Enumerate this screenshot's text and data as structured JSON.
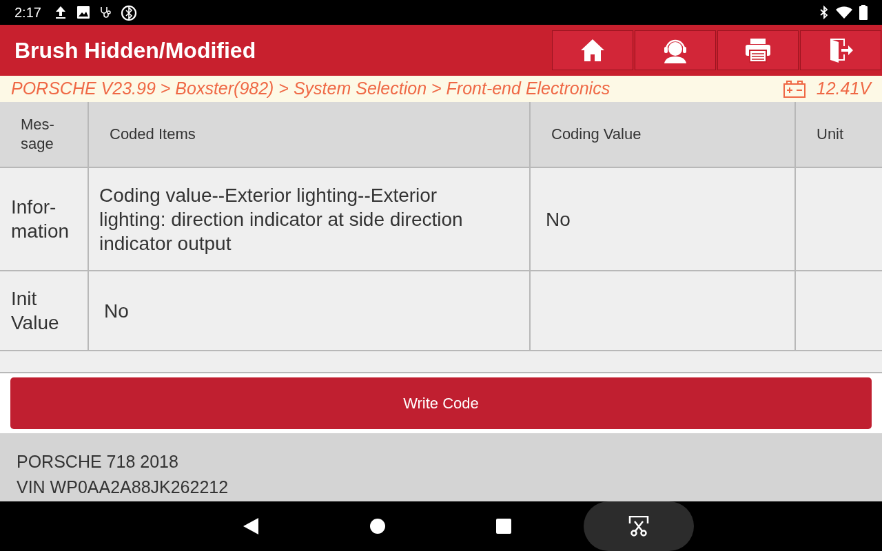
{
  "status_bar": {
    "time": "2:17"
  },
  "header": {
    "title": "Brush Hidden/Modified",
    "buttons": [
      {
        "kind": "home"
      },
      {
        "kind": "support"
      },
      {
        "kind": "print"
      },
      {
        "kind": "exit"
      }
    ]
  },
  "breadcrumb": {
    "path": "PORSCHE V23.99 > Boxster(982) > System Selection > Front-end Electronics",
    "voltage": "12.41V"
  },
  "table": {
    "columns": [
      "Mes-\nsage",
      "Coded Items",
      "Coding Value",
      "Unit"
    ],
    "rows": [
      [
        "Infor-\nmation",
        " Coding value--Exterior lighting--Exterior lighting: direction indicator at side direction indicator output",
        "No",
        ""
      ],
      [
        "Init\nValue",
        "No",
        "",
        ""
      ]
    ]
  },
  "write_button": "Write Code",
  "footer": {
    "vehicle": "PORSCHE 718 2018",
    "vin": "VIN WP0AA2A88JK262212"
  }
}
